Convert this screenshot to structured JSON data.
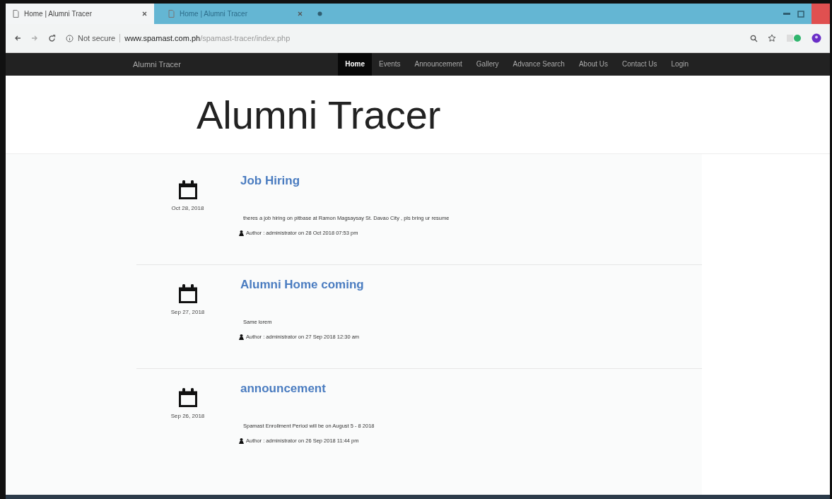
{
  "browser": {
    "tabs": [
      {
        "title": "Home | Alumni Tracer",
        "selected": true
      },
      {
        "title": "Home | Alumni Tracer",
        "selected": false
      }
    ],
    "security": "Not secure",
    "url_host": "www.spamast.com.ph",
    "url_path": "/spamast-tracer/index.php"
  },
  "navbar": {
    "brand": "Alumni Tracer",
    "items": [
      {
        "label": "Home",
        "selected": true
      },
      {
        "label": "Events",
        "selected": false
      },
      {
        "label": "Announcement",
        "selected": false
      },
      {
        "label": "Gallery",
        "selected": false
      },
      {
        "label": "Advance Search",
        "selected": false
      },
      {
        "label": "About Us",
        "selected": false
      },
      {
        "label": "Contact Us",
        "selected": false
      },
      {
        "label": "Login",
        "selected": false
      }
    ]
  },
  "header": {
    "title": "Alumni Tracer"
  },
  "posts": [
    {
      "date": "Oct 28, 2018",
      "title": "Job Hiring",
      "body": "theres a job hiring on pitbase at Ramon Magsaysay St. Davao City , pls bring ur resume",
      "author": "Author : administrator on 28 Oct 2018 07:53 pm"
    },
    {
      "date": "Sep 27, 2018",
      "title": "Alumni Home coming",
      "body": "Same lorem",
      "author": "Author : administrator on 27 Sep 2018 12:30 am"
    },
    {
      "date": "Sep 26, 2018",
      "title": "announcement",
      "body": "Spamast Enrollment Period will be on August 5 - 8 2018",
      "author": "Author : administrator on 26 Sep 2018 11:44 pm"
    }
  ]
}
